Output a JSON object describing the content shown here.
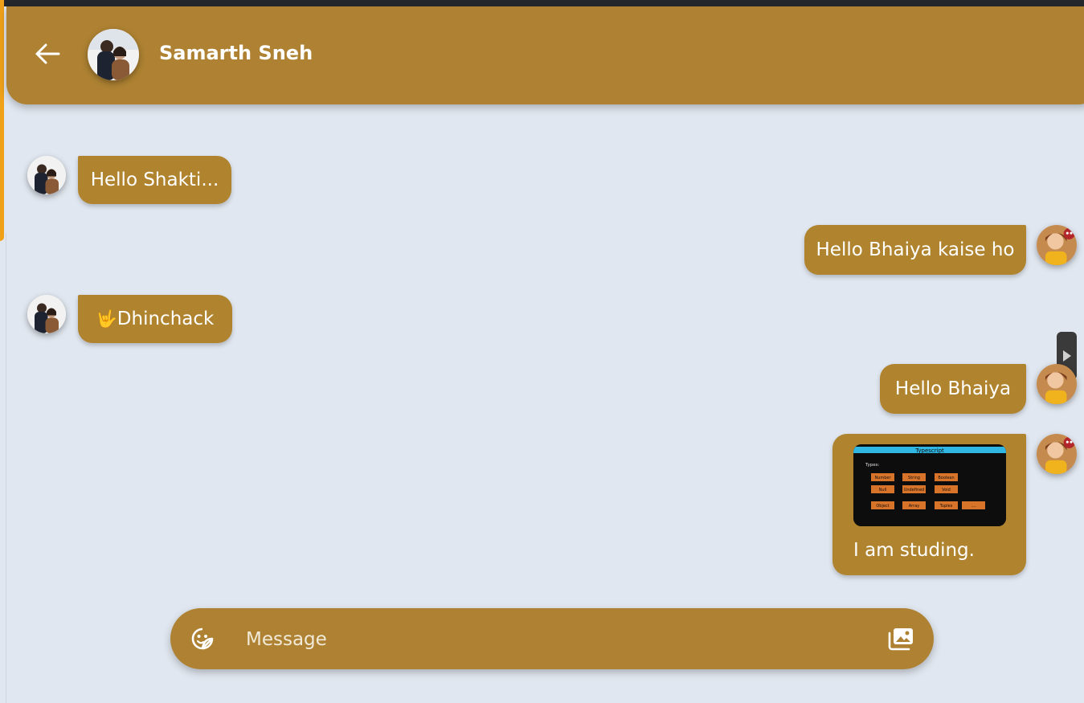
{
  "header": {
    "contact_name": "Samarth Sneh"
  },
  "messages": [
    {
      "side": "left",
      "text": "Hello Shakti..."
    },
    {
      "side": "right",
      "text": "Hello Bhaiya kaise ho"
    },
    {
      "side": "left",
      "emoji": "🤟",
      "text": "Dhinchack"
    },
    {
      "side": "right",
      "text": "Hello Bhaiya"
    },
    {
      "side": "right",
      "caption": "I am studing.",
      "image": {
        "title": "Typescript",
        "label": "Types:",
        "rows": [
          [
            "Number",
            "String",
            "Boolean"
          ],
          [
            "Null",
            "Undefined",
            "Void"
          ],
          [
            "Object",
            "Array",
            "Tuples",
            "...."
          ]
        ]
      }
    }
  ],
  "composer": {
    "placeholder": "Message"
  },
  "icons": {
    "back": "arrow-left-icon",
    "emoji": "sticker-emoji-icon",
    "gallery": "image-gallery-icon",
    "side_handle": "play-icon"
  },
  "colors": {
    "accent": "#ae8232",
    "bubble": "#b0842e",
    "background": "#e1e7f0",
    "text": "#ffffff"
  }
}
